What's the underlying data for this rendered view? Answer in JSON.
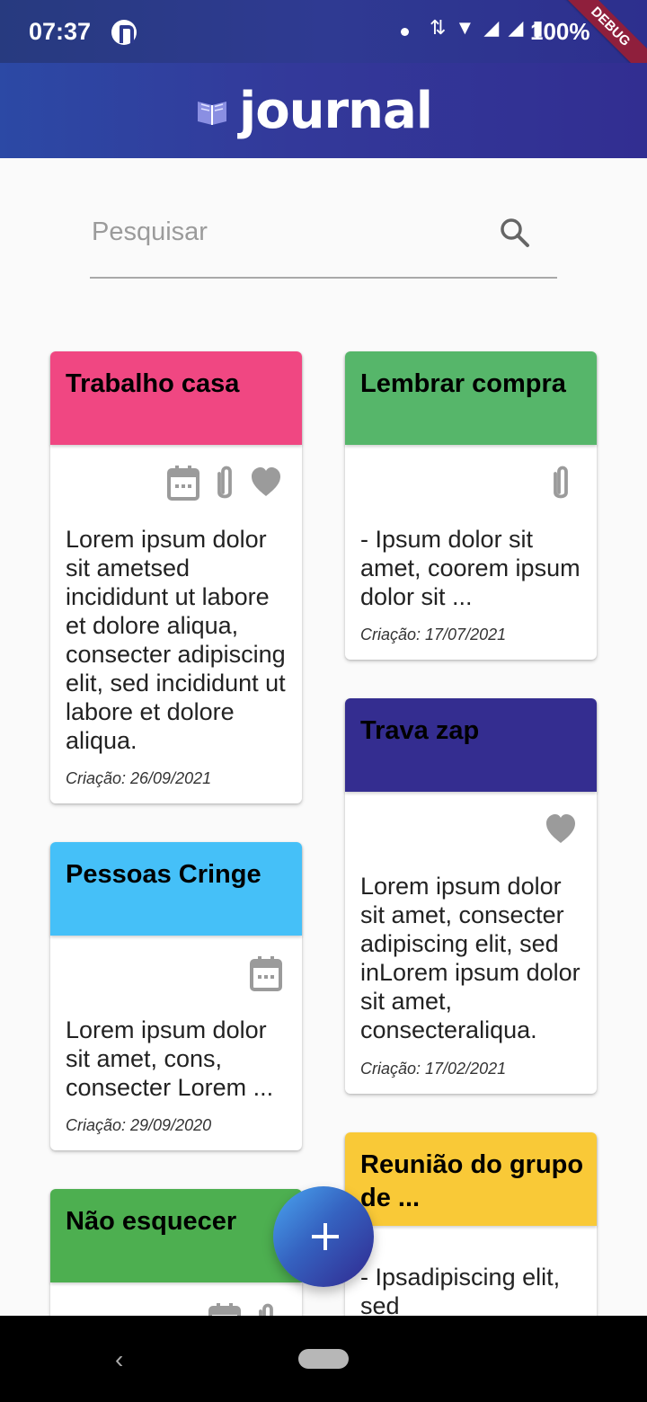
{
  "status": {
    "time": "07:37",
    "battery": "100%",
    "debug": "DEBUG",
    "icons": "⇅ ▼ ◢ ◢ ▮"
  },
  "app_bar": {
    "title": "journal",
    "icon": "book-icon"
  },
  "search": {
    "placeholder": "Pesquisar",
    "value": "",
    "icon": "search-icon"
  },
  "cards": [
    {
      "title": "Trabalho casa",
      "color": "#f04782",
      "icons": [
        "calendar-icon",
        "paperclip-icon",
        "heart-icon"
      ],
      "body": "Lorem ipsum dolor sit ametsed incididunt ut labore et dolore aliqua, consecter adipiscing elit, sed incididunt ut labore et dolore aliqua.",
      "date": "Criação: 26/09/2021"
    },
    {
      "title": "Lembrar compra",
      "color": "#56b66a",
      "icons": [
        "paperclip-icon"
      ],
      "body": "- Ipsum dolor sit amet, coorem ipsum dolor sit ...",
      "date": "Criação: 17/07/2021"
    },
    {
      "title": "Trava zap",
      "color": "#342d90",
      "icons": [
        "heart-icon"
      ],
      "body": "Lorem ipsum dolor sit amet, consecter adipiscing elit, sed inLorem ipsum dolor sit amet, consecteraliqua.",
      "date": "Criação: 17/02/2021"
    },
    {
      "title": "Pessoas Cringe",
      "color": "#45c0f8",
      "icons": [
        "calendar-icon"
      ],
      "body": "Lorem ipsum dolor sit amet, cons, consecter Lorem ...",
      "date": "Criação: 29/09/2020"
    },
    {
      "title": "Reunião do grupo de ...",
      "color": "#f9c937",
      "icons": [],
      "body": "- Ipsadipiscing elit, sed",
      "date": ""
    },
    {
      "title": "Não esquecer",
      "color": "#4daf50",
      "icons": [
        "calendar-icon",
        "paperclip-icon"
      ],
      "body": "",
      "date": ""
    }
  ],
  "fab": {
    "icon": "plus-icon"
  },
  "nav": {
    "back": "‹"
  }
}
